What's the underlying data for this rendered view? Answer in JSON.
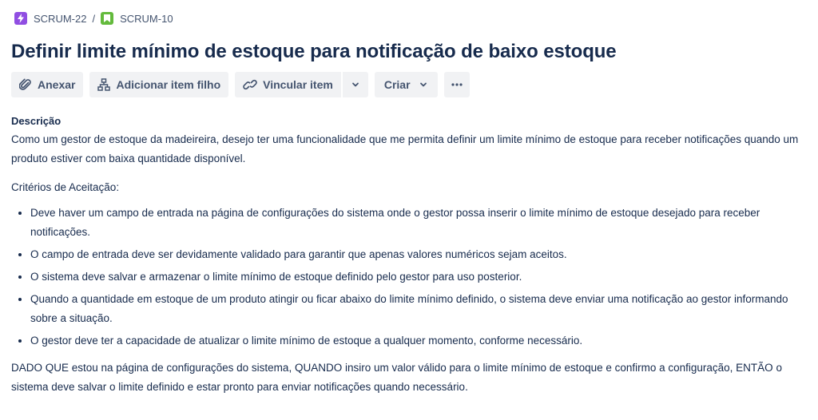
{
  "breadcrumb": {
    "parent": {
      "key": "SCRUM-22",
      "icon": "epic-lightning-icon"
    },
    "separator": "/",
    "current": {
      "key": "SCRUM-10",
      "icon": "story-bookmark-icon"
    }
  },
  "issue": {
    "title": "Definir limite mínimo de estoque para notificação de baixo estoque"
  },
  "toolbar": {
    "attach_label": "Anexar",
    "add_child_label": "Adicionar item filho",
    "link_label": "Vincular item",
    "create_label": "Criar"
  },
  "description": {
    "label": "Descrição",
    "intro": "Como um gestor de estoque da madeireira, desejo ter uma funcionalidade que me permita definir um limite mínimo de estoque para receber notificações quando um produto estiver com baixa quantidade disponível.",
    "criteria_heading": "Critérios de Aceitação:",
    "criteria": [
      "Deve haver um campo de entrada na página de configurações do sistema onde o gestor possa inserir o limite mínimo de estoque desejado para receber notificações.",
      "O campo de entrada deve ser devidamente validado para garantir que apenas valores numéricos sejam aceitos.",
      "O sistema deve salvar e armazenar o limite mínimo de estoque definido pelo gestor para uso posterior.",
      "Quando a quantidade em estoque de um produto atingir ou ficar abaixo do limite mínimo definido, o sistema deve enviar uma notificação ao gestor informando sobre a situação.",
      "O gestor deve ter a capacidade de atualizar o limite mínimo de estoque a qualquer momento, conforme necessário."
    ],
    "scenario": "DADO QUE estou na página de configurações do sistema, QUANDO insiro um valor válido para o limite mínimo de estoque e confirmo a configuração, ENTÃO o sistema deve salvar o limite definido e estar pronto para enviar notificações quando necessário."
  },
  "colors": {
    "epic": "#904ee2",
    "story": "#63ba3c",
    "text": "#172b4d",
    "subtle_text": "#44546f",
    "button_bg": "#f1f2f4"
  }
}
